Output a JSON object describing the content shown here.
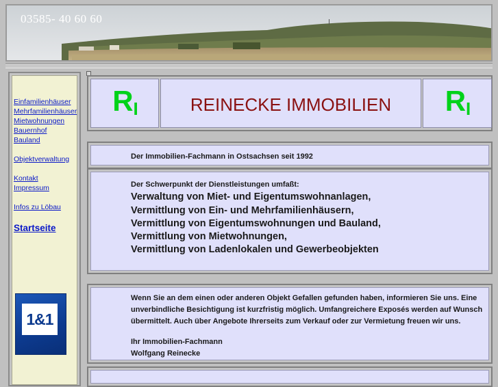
{
  "header": {
    "phone": "03585- 40 60 60"
  },
  "sidebar": {
    "links": [
      {
        "label": "Einfamilienhäuser"
      },
      {
        "label": "Mehrfamilienhäuser"
      },
      {
        "label": "Mietwohnungen"
      },
      {
        "label": "Bauernhof"
      },
      {
        "label": "Bauland"
      },
      {
        "label": "Objektverwaltung"
      },
      {
        "label": "Kontakt"
      },
      {
        "label": "Impressum"
      },
      {
        "label": "Infos zu Löbau"
      }
    ],
    "home": "Startseite",
    "partner_logo": {
      "text": "1&1",
      "color": "#0c3a8e"
    }
  },
  "title_row": {
    "logo_left": {
      "main": "R",
      "sub": "I"
    },
    "company": "REINECKE IMMOBILIEN",
    "logo_right": {
      "main": "R",
      "sub": "I"
    },
    "logo_color": "#00d21a",
    "company_color": "#8a1111"
  },
  "tagline": "Der Immobilien-Fachmann in Ostsachsen seit 1992",
  "services": {
    "intro": "Der Schwerpunkt der Dienstleistungen umfaßt:",
    "items": [
      "Verwaltung von Miet- und Eigentumswohnanlagen,",
      "Vermittlung von Ein- und Mehrfamilienhäusern,",
      "Vermittlung von Eigentumswohnungen und Bauland,",
      "Vermittlung von Mietwohnungen,",
      "Vermittlung von Ladenlokalen und Gewerbeobjekten"
    ]
  },
  "contact_note": {
    "lines": [
      "Wenn Sie an dem einen oder anderen Objekt Gefallen gefunden haben, informieren Sie uns. Eine",
      "unverbindliche Besichtigung ist kurzfristig möglich. Umfangreichere Exposés werden auf Wunsch",
      "übermittelt. Auch über Angebote Ihrerseits zum Verkauf oder zur Vermietung freuen wir uns."
    ],
    "signature_title": "Ihr Immobilien-Fachmann",
    "signature_name": "Wolfgang Reinecke"
  },
  "colors": {
    "page_bg": "#c0c0c0",
    "panel_bg": "#e0e0fb",
    "sidebar_bg": "#f2f2d3",
    "link": "#0a18c8"
  }
}
